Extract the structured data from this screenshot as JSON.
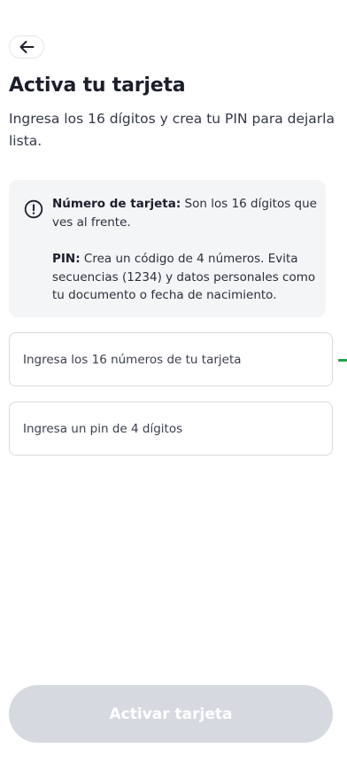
{
  "header": {
    "back_icon": "arrow-left-icon"
  },
  "page": {
    "title": "Activa tu tarjeta",
    "subtitle": "Ingresa los 16 dígitos y crea tu PIN para dejarla lista."
  },
  "info_card": {
    "icon": "exclamation-circle-icon",
    "card_number_label": "Número de tarjeta:",
    "card_number_text": " Son los 16 dígitos que ves al frente.",
    "pin_label": "PIN:",
    "pin_text": " Crea un código de 4 números. Evita secuencias (1234) y datos personales como tu documento o fecha de nacimiento."
  },
  "form": {
    "card_number": {
      "value": "",
      "placeholder": "Ingresa los 16 números de tu tarjeta"
    },
    "pin": {
      "value": "",
      "placeholder": "Ingresa un pin de 4 dígitos"
    }
  },
  "actions": {
    "submit_label": "Activar tarjeta",
    "submit_enabled": false
  },
  "colors": {
    "text_primary": "#1c1f2b",
    "card_background": "#f4f5f7",
    "input_border": "#d7dae0",
    "button_disabled_bg": "#d6d9e0",
    "button_disabled_text": "#ffffff",
    "edge_accent": "#1fa34a"
  }
}
